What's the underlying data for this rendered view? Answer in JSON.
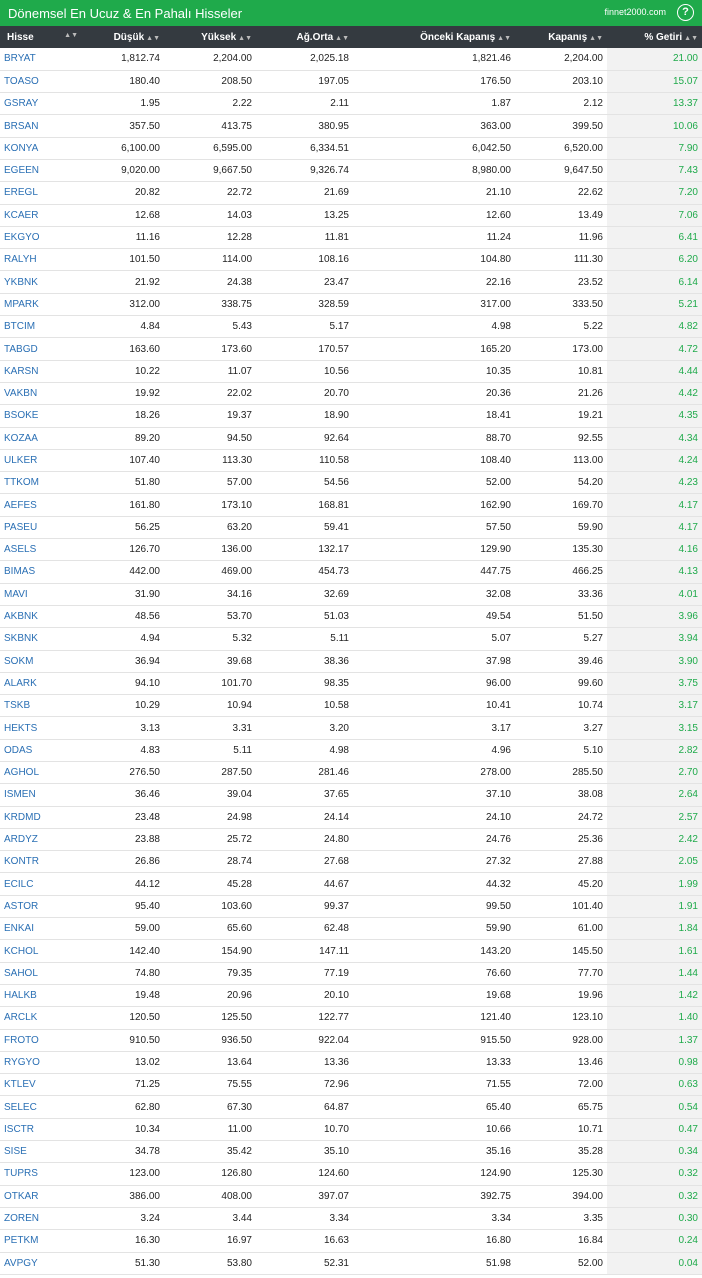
{
  "header": {
    "title": "Dönemsel En Ucuz & En Pahalı Hisseler",
    "brand": "finnet2000.com",
    "help": "?"
  },
  "columns": [
    "Hisse",
    "Düşük",
    "Yüksek",
    "Ağ.Orta",
    "Önceki Kapanış",
    "Kapanış",
    "% Getiri"
  ],
  "rows": [
    [
      "BRYAT",
      "1,812.74",
      "2,204.00",
      "2,025.18",
      "1,821.46",
      "2,204.00",
      "21.00"
    ],
    [
      "TOASO",
      "180.40",
      "208.50",
      "197.05",
      "176.50",
      "203.10",
      "15.07"
    ],
    [
      "GSRAY",
      "1.95",
      "2.22",
      "2.11",
      "1.87",
      "2.12",
      "13.37"
    ],
    [
      "BRSAN",
      "357.50",
      "413.75",
      "380.95",
      "363.00",
      "399.50",
      "10.06"
    ],
    [
      "KONYA",
      "6,100.00",
      "6,595.00",
      "6,334.51",
      "6,042.50",
      "6,520.00",
      "7.90"
    ],
    [
      "EGEEN",
      "9,020.00",
      "9,667.50",
      "9,326.74",
      "8,980.00",
      "9,647.50",
      "7.43"
    ],
    [
      "EREGL",
      "20.82",
      "22.72",
      "21.69",
      "21.10",
      "22.62",
      "7.20"
    ],
    [
      "KCAER",
      "12.68",
      "14.03",
      "13.25",
      "12.60",
      "13.49",
      "7.06"
    ],
    [
      "EKGYO",
      "11.16",
      "12.28",
      "11.81",
      "11.24",
      "11.96",
      "6.41"
    ],
    [
      "RALYH",
      "101.50",
      "114.00",
      "108.16",
      "104.80",
      "111.30",
      "6.20"
    ],
    [
      "YKBNK",
      "21.92",
      "24.38",
      "23.47",
      "22.16",
      "23.52",
      "6.14"
    ],
    [
      "MPARK",
      "312.00",
      "338.75",
      "328.59",
      "317.00",
      "333.50",
      "5.21"
    ],
    [
      "BTCIM",
      "4.84",
      "5.43",
      "5.17",
      "4.98",
      "5.22",
      "4.82"
    ],
    [
      "TABGD",
      "163.60",
      "173.60",
      "170.57",
      "165.20",
      "173.00",
      "4.72"
    ],
    [
      "KARSN",
      "10.22",
      "11.07",
      "10.56",
      "10.35",
      "10.81",
      "4.44"
    ],
    [
      "VAKBN",
      "19.92",
      "22.02",
      "20.70",
      "20.36",
      "21.26",
      "4.42"
    ],
    [
      "BSOKE",
      "18.26",
      "19.37",
      "18.90",
      "18.41",
      "19.21",
      "4.35"
    ],
    [
      "KOZAA",
      "89.20",
      "94.50",
      "92.64",
      "88.70",
      "92.55",
      "4.34"
    ],
    [
      "ULKER",
      "107.40",
      "113.30",
      "110.58",
      "108.40",
      "113.00",
      "4.24"
    ],
    [
      "TTKOM",
      "51.80",
      "57.00",
      "54.56",
      "52.00",
      "54.20",
      "4.23"
    ],
    [
      "AEFES",
      "161.80",
      "173.10",
      "168.81",
      "162.90",
      "169.70",
      "4.17"
    ],
    [
      "PASEU",
      "56.25",
      "63.20",
      "59.41",
      "57.50",
      "59.90",
      "4.17"
    ],
    [
      "ASELS",
      "126.70",
      "136.00",
      "132.17",
      "129.90",
      "135.30",
      "4.16"
    ],
    [
      "BIMAS",
      "442.00",
      "469.00",
      "454.73",
      "447.75",
      "466.25",
      "4.13"
    ],
    [
      "MAVI",
      "31.90",
      "34.16",
      "32.69",
      "32.08",
      "33.36",
      "4.01"
    ],
    [
      "AKBNK",
      "48.56",
      "53.70",
      "51.03",
      "49.54",
      "51.50",
      "3.96"
    ],
    [
      "SKBNK",
      "4.94",
      "5.32",
      "5.11",
      "5.07",
      "5.27",
      "3.94"
    ],
    [
      "SOKM",
      "36.94",
      "39.68",
      "38.36",
      "37.98",
      "39.46",
      "3.90"
    ],
    [
      "ALARK",
      "94.10",
      "101.70",
      "98.35",
      "96.00",
      "99.60",
      "3.75"
    ],
    [
      "TSKB",
      "10.29",
      "10.94",
      "10.58",
      "10.41",
      "10.74",
      "3.17"
    ],
    [
      "HEKTS",
      "3.13",
      "3.31",
      "3.20",
      "3.17",
      "3.27",
      "3.15"
    ],
    [
      "ODAS",
      "4.83",
      "5.11",
      "4.98",
      "4.96",
      "5.10",
      "2.82"
    ],
    [
      "AGHOL",
      "276.50",
      "287.50",
      "281.46",
      "278.00",
      "285.50",
      "2.70"
    ],
    [
      "ISMEN",
      "36.46",
      "39.04",
      "37.65",
      "37.10",
      "38.08",
      "2.64"
    ],
    [
      "KRDMD",
      "23.48",
      "24.98",
      "24.14",
      "24.10",
      "24.72",
      "2.57"
    ],
    [
      "ARDYZ",
      "23.88",
      "25.72",
      "24.80",
      "24.76",
      "25.36",
      "2.42"
    ],
    [
      "KONTR",
      "26.86",
      "28.74",
      "27.68",
      "27.32",
      "27.88",
      "2.05"
    ],
    [
      "ECILC",
      "44.12",
      "45.28",
      "44.67",
      "44.32",
      "45.20",
      "1.99"
    ],
    [
      "ASTOR",
      "95.40",
      "103.60",
      "99.37",
      "99.50",
      "101.40",
      "1.91"
    ],
    [
      "ENKAI",
      "59.00",
      "65.60",
      "62.48",
      "59.90",
      "61.00",
      "1.84"
    ],
    [
      "KCHOL",
      "142.40",
      "154.90",
      "147.11",
      "143.20",
      "145.50",
      "1.61"
    ],
    [
      "SAHOL",
      "74.80",
      "79.35",
      "77.19",
      "76.60",
      "77.70",
      "1.44"
    ],
    [
      "HALKB",
      "19.48",
      "20.96",
      "20.10",
      "19.68",
      "19.96",
      "1.42"
    ],
    [
      "ARCLK",
      "120.50",
      "125.50",
      "122.77",
      "121.40",
      "123.10",
      "1.40"
    ],
    [
      "FROTO",
      "910.50",
      "936.50",
      "922.04",
      "915.50",
      "928.00",
      "1.37"
    ],
    [
      "RYGYO",
      "13.02",
      "13.64",
      "13.36",
      "13.33",
      "13.46",
      "0.98"
    ],
    [
      "KTLEV",
      "71.25",
      "75.55",
      "72.96",
      "71.55",
      "72.00",
      "0.63"
    ],
    [
      "SELEC",
      "62.80",
      "67.30",
      "64.87",
      "65.40",
      "65.75",
      "0.54"
    ],
    [
      "ISCTR",
      "10.34",
      "11.00",
      "10.70",
      "10.66",
      "10.71",
      "0.47"
    ],
    [
      "SISE",
      "34.78",
      "35.42",
      "35.10",
      "35.16",
      "35.28",
      "0.34"
    ],
    [
      "TUPRS",
      "123.00",
      "126.80",
      "124.60",
      "124.90",
      "125.30",
      "0.32"
    ],
    [
      "OTKAR",
      "386.00",
      "408.00",
      "397.07",
      "392.75",
      "394.00",
      "0.32"
    ],
    [
      "ZOREN",
      "3.24",
      "3.44",
      "3.34",
      "3.34",
      "3.35",
      "0.30"
    ],
    [
      "PETKM",
      "16.30",
      "16.97",
      "16.63",
      "16.80",
      "16.84",
      "0.24"
    ],
    [
      "AVPGY",
      "51.30",
      "53.80",
      "52.31",
      "51.98",
      "52.00",
      "0.04"
    ]
  ]
}
